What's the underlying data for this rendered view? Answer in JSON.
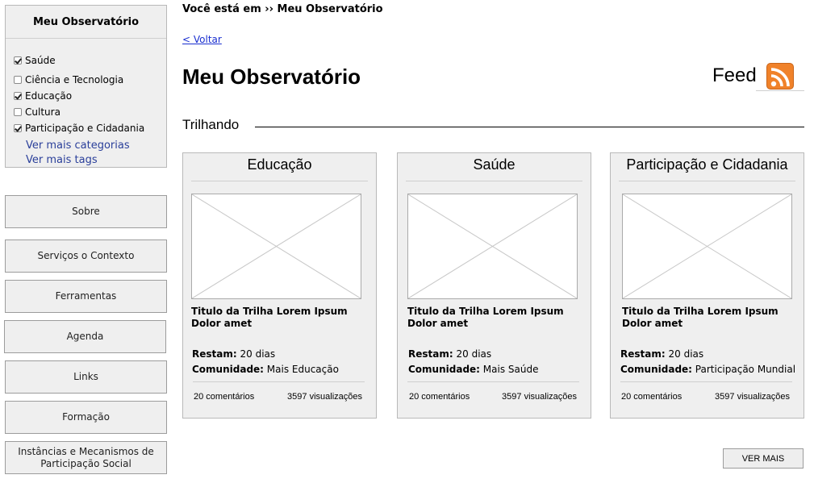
{
  "sidebar": {
    "panel_title": "Meu Observatório",
    "categories": [
      {
        "label": "Saúde",
        "checked": true
      },
      {
        "label": "Ciência e Tecnologia",
        "checked": false
      },
      {
        "label": "Educação",
        "checked": true
      },
      {
        "label": "Cultura",
        "checked": false
      },
      {
        "label": "Participação e Cidadania",
        "checked": true
      }
    ],
    "more_categories": "Ver mais categorias",
    "more_tags": "Ver mais tags",
    "nav": [
      "Sobre",
      "Serviços o Contexto",
      "Ferramentas",
      "Agenda",
      "Links",
      "Formação",
      "Instâncias e Mecanismos de Participação Social"
    ]
  },
  "header": {
    "breadcrumb": "Você está em ›› Meu Observatório",
    "back": "< Voltar",
    "title": "Meu Observatório",
    "feed_label": "Feed"
  },
  "section": {
    "title": "Trilhando"
  },
  "cards": [
    {
      "title": "Educação",
      "subtitle": "Titulo da Trilha Lorem Ipsum Dolor amet",
      "remaining_label": "Restam:",
      "remaining": "20 dias",
      "community_label": "Comunidade:",
      "community": "Mais Educação",
      "comments": "20 comentários",
      "views": "3597 visualizações"
    },
    {
      "title": "Saúde",
      "subtitle": "Titulo da Trilha Lorem Ipsum Dolor amet",
      "remaining_label": "Restam:",
      "remaining": "20 dias",
      "community_label": "Comunidade:",
      "community": "Mais Saúde",
      "comments": "20 comentários",
      "views": "3597 visualizações"
    },
    {
      "title": "Participação e Cidadania",
      "subtitle": "Titulo da Trilha Lorem Ipsum Dolor amet",
      "remaining_label": "Restam:",
      "remaining": "20 dias",
      "community_label": "Comunidade:",
      "community": "Participação Mundial",
      "comments": "20 comentários",
      "views": "3597 visualizações"
    }
  ],
  "ver_mais": "VER MAIS",
  "colors": {
    "rss": "#f0822a",
    "link": "#1a2fd0",
    "panel_bg": "#efefef"
  }
}
